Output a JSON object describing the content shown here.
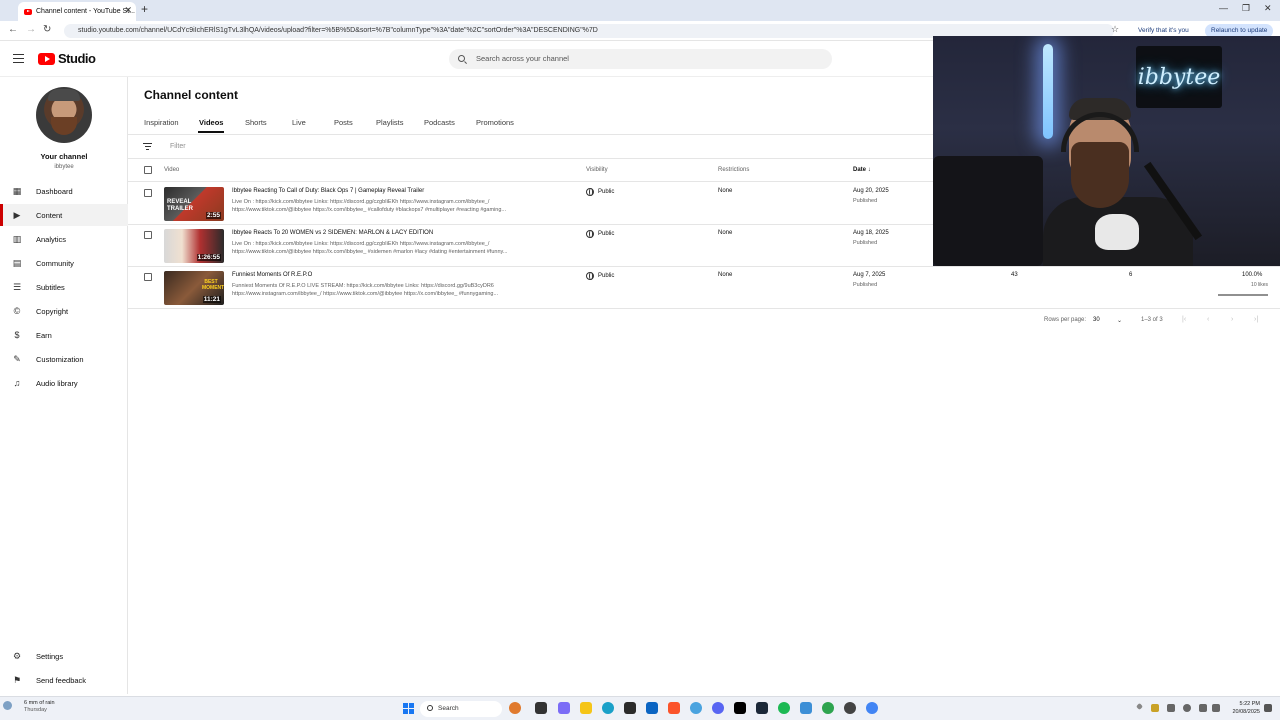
{
  "browser": {
    "tab_title": "Channel content - YouTube St...",
    "url": "studio.youtube.com/channel/UCdYc9iIchERlS1gTvL3lhQA/videos/upload?filter=%5B%5D&sort=%7B\"columnType\"%3A\"date\"%2C\"sortOrder\"%3A\"DESCENDING\"%7D",
    "verify_label": "Verify that it's you",
    "relaunch_label": "Relaunch to update"
  },
  "header": {
    "logo_text": "Studio",
    "search_placeholder": "Search across your channel"
  },
  "sidebar": {
    "channel_label": "Your channel",
    "channel_handle": "ibbytee",
    "items": [
      {
        "label": "Dashboard",
        "icon": "dashboard-icon",
        "glyph": "▦"
      },
      {
        "label": "Content",
        "icon": "content-icon",
        "glyph": "▶"
      },
      {
        "label": "Analytics",
        "icon": "analytics-icon",
        "glyph": "▥"
      },
      {
        "label": "Community",
        "icon": "community-icon",
        "glyph": "▤"
      },
      {
        "label": "Subtitles",
        "icon": "subtitles-icon",
        "glyph": "☰"
      },
      {
        "label": "Copyright",
        "icon": "copyright-icon",
        "glyph": "©"
      },
      {
        "label": "Earn",
        "icon": "earn-icon",
        "glyph": "$"
      },
      {
        "label": "Customization",
        "icon": "customization-icon",
        "glyph": "✎"
      },
      {
        "label": "Audio library",
        "icon": "audio-library-icon",
        "glyph": "♫"
      }
    ],
    "settings_label": "Settings",
    "feedback_label": "Send feedback"
  },
  "main": {
    "title": "Channel content",
    "tabs": [
      "Inspiration",
      "Videos",
      "Shorts",
      "Live",
      "Posts",
      "Playlists",
      "Podcasts",
      "Promotions"
    ],
    "active_tab": "Videos",
    "filter_placeholder": "Filter",
    "columns": {
      "video": "Video",
      "visibility": "Visibility",
      "restrictions": "Restrictions",
      "date": "Date"
    },
    "rows": [
      {
        "title": "Ibbytee Reacting To Call of Duty: Black Ops 7 | Gameplay Reveal Trailer",
        "description": "Live On : https://kick.com/ibbytee Links: https://discord.gg/czgbIiEKh https://www.instagram.com/ibbytee_/\nhttps://www.tiktok.com/@ibbytee https://x.com/ibbytee_ #callofduty #blackops7 #multiplayer #reacting #gaming...",
        "duration": "2:55",
        "visibility": "Public",
        "restrictions": "None",
        "date": "Aug 20, 2025",
        "status": "Published",
        "thumb_text": "REVEAL TRAILER"
      },
      {
        "title": "Ibbytee Reacts To 20 WOMEN vs 2 SIDEMEN: MARLON & LACY EDITION",
        "description": "Live On : https://kick.com/ibbytee Links: https://discord.gg/czgbIiEKh https://www.instagram.com/ibbytee_/\nhttps://www.tiktok.com/@ibbytee https://x.com/ibbytee_ #sidemen #marlon #lacy #dating #entertainment #funny...",
        "duration": "1:26:55",
        "visibility": "Public",
        "restrictions": "None",
        "date": "Aug 18, 2025",
        "status": "Published",
        "thumb_text": ""
      },
      {
        "title": "Funniest Moments Of R.E.P.O",
        "description": "Funniest Moments Of R.E.P.O LIVE STREAM: https://kick.com/ibbytee Links: https://discord.gg/9uB3cyDR6\nhttps://www.instagram.com/ibbytee_/ https://www.tiktok.com/@ibbytee https://x.com/ibbytee_ #funnygaming...",
        "duration": "11:21",
        "visibility": "Public",
        "restrictions": "None",
        "date": "Aug 7, 2025",
        "status": "Published",
        "views": "43",
        "comments": "6",
        "likes_pct": "100.0%",
        "likes_sub": "10 likes",
        "thumb_text": "BEST MOMENTS"
      }
    ],
    "pagination": {
      "rows_per_page_label": "Rows per page:",
      "rows_per_page": "30",
      "range": "1–3 of 3"
    }
  },
  "webcam": {
    "sign_text": "ibbytee"
  },
  "taskbar": {
    "weather_line1": "6 mm of rain",
    "weather_line2": "Thursday",
    "search_label": "Search",
    "time": "5:22 PM",
    "date": "20/08/2025"
  },
  "colors": {
    "accent_red": "#ff0000",
    "active_indicator": "#cc0000",
    "windows_blue": "#1877f2"
  }
}
